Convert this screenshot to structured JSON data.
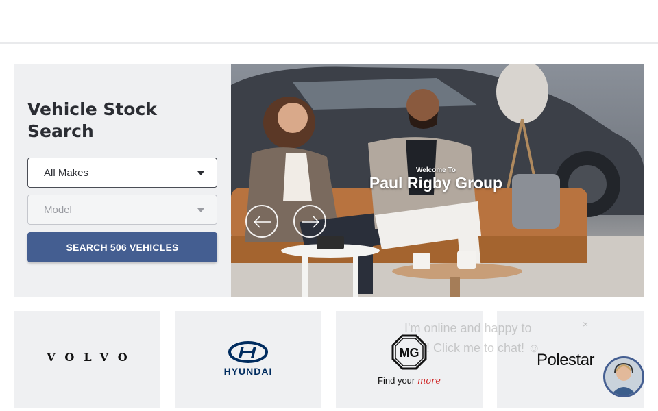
{
  "search": {
    "title": "Vehicle Stock Search",
    "make_value": "All Makes",
    "model_placeholder": "Model",
    "button_label": "SEARCH 506 VEHICLES"
  },
  "hero": {
    "welcome": "Welcome To",
    "title": "Paul Rigby Group",
    "prev_icon": "arrow-left-icon",
    "next_icon": "arrow-right-icon"
  },
  "brands": [
    {
      "name": "VOLVO"
    },
    {
      "name": "HYUNDAI"
    },
    {
      "name": "MG",
      "tagline": "Find your",
      "tagline_accent": "more"
    },
    {
      "name": "Polestar"
    }
  ],
  "chat": {
    "line1": "I'm online and happy to",
    "line2": "! Click me to chat! ☺",
    "close": "×"
  },
  "colors": {
    "button": "#445e91",
    "panel": "#eff0f2",
    "hyundai": "#002c5f",
    "mg_accent": "#d02a2a"
  }
}
